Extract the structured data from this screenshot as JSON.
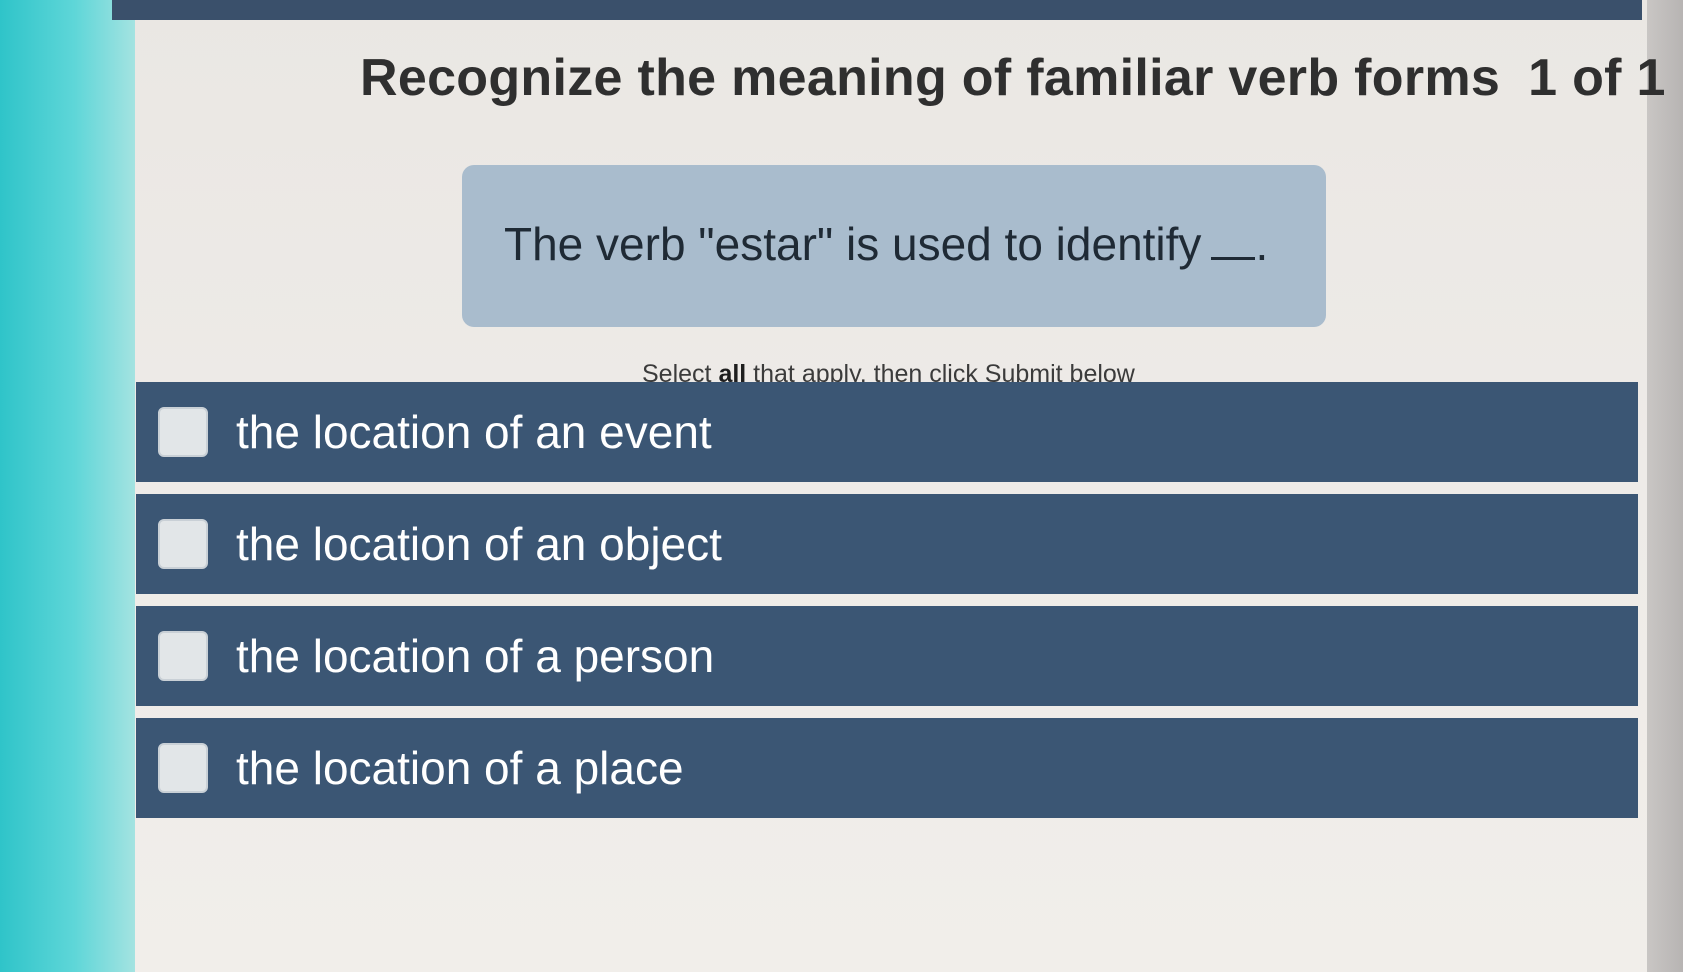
{
  "header": {
    "title": "Recognize the meaning of familiar verb forms",
    "counter": "1 of 1"
  },
  "question": {
    "text": "The verb \"estar\" is used to identify",
    "blank_suffix": "."
  },
  "instruction": {
    "prefix": "Select ",
    "emphasis": "all",
    "suffix": " that apply, then click Submit below"
  },
  "options": [
    {
      "label": "the location of an event",
      "checked": false
    },
    {
      "label": "the location of an object",
      "checked": false
    },
    {
      "label": "the location of a person",
      "checked": false
    },
    {
      "label": "the location of a place",
      "checked": false
    }
  ],
  "colors": {
    "option_background": "#3b5674",
    "question_box": "#a9bccd",
    "top_bar": "#3a506b"
  }
}
